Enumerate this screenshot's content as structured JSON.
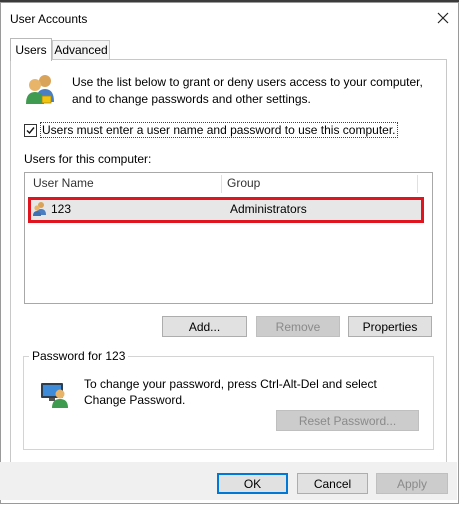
{
  "window": {
    "title": "User Accounts",
    "close_glyph": "✕"
  },
  "tabs": [
    {
      "label": "Users",
      "active": true
    },
    {
      "label": "Advanced",
      "active": false
    }
  ],
  "users_tab": {
    "intro_text": "Use the list below to grant or deny users access to your computer, and to change passwords and other settings.",
    "require_login_checkbox": {
      "label": "Users must enter a user name and password to use this computer.",
      "checked": true
    },
    "users_list_label": "Users for this computer:",
    "columns": [
      "User Name",
      "Group"
    ],
    "rows": [
      {
        "user_name": "123",
        "group": "Administrators",
        "selected": true
      }
    ],
    "buttons": {
      "add": "Add...",
      "remove": "Remove",
      "properties": "Properties"
    },
    "password_group": {
      "title": "Password for 123",
      "text": "To change your password, press Ctrl-Alt-Del and select Change Password.",
      "reset_button": "Reset Password..."
    }
  },
  "footer": {
    "ok": "OK",
    "cancel": "Cancel",
    "apply": "Apply"
  },
  "colors": {
    "selection_highlight": "#e0141e",
    "default_button_border": "#0078d7"
  }
}
